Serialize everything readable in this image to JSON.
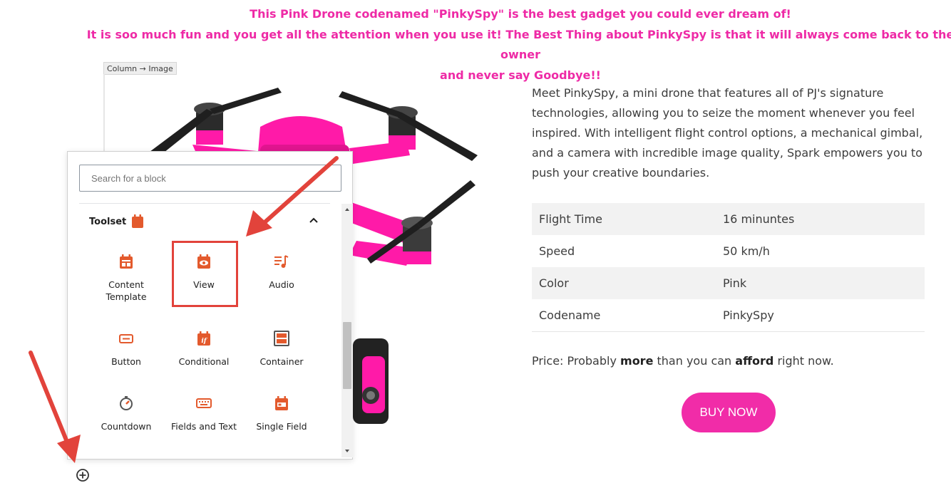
{
  "headline": {
    "line1": "This Pink Drone codenamed \"PinkySpy\" is the best gadget you could ever dream of!",
    "line2": "It is soo much fun and you get all the attention when you use it! The Best Thing about PinkySpy is that it will always come back to the owner",
    "line3": "and never say Goodbye!!"
  },
  "breadcrumb": "Column → Image",
  "description": "Meet PinkySpy, a mini drone that features all of PJ's signature technologies, allowing you to seize the moment whenever you feel inspired. With intelligent flight control options, a mechanical gimbal, and a camera with incredible image quality, Spark empowers you to push your creative boundaries.",
  "specs": [
    {
      "label": "Flight Time",
      "value": "16 minuntes"
    },
    {
      "label": "Speed",
      "value": "50 km/h"
    },
    {
      "label": "Color",
      "value": "Pink"
    },
    {
      "label": "Codename",
      "value": "PinkySpy"
    }
  ],
  "price": {
    "prefix": "Price: Probably ",
    "bold1": "more",
    "middle": " than you can ",
    "bold2": "afford",
    "suffix": " right now."
  },
  "buy_button": "BUY NOW",
  "inserter": {
    "search_placeholder": "Search for a block",
    "category": "Toolset",
    "blocks": [
      {
        "label": "Content Template",
        "icon": "content-template-icon"
      },
      {
        "label": "View",
        "icon": "view-icon"
      },
      {
        "label": "Audio",
        "icon": "audio-icon"
      },
      {
        "label": "Button",
        "icon": "button-icon"
      },
      {
        "label": "Conditional",
        "icon": "conditional-icon"
      },
      {
        "label": "Container",
        "icon": "container-icon"
      },
      {
        "label": "Countdown",
        "icon": "countdown-icon"
      },
      {
        "label": "Fields and Text",
        "icon": "fields-and-text-icon"
      },
      {
        "label": "Single Field",
        "icon": "single-field-icon"
      }
    ]
  },
  "colors": {
    "accent_pink": "#f12ca8",
    "headline_pink": "#ee2aa6",
    "toolset_orange": "#e35a2d",
    "annotation_red": "#e2433b"
  }
}
